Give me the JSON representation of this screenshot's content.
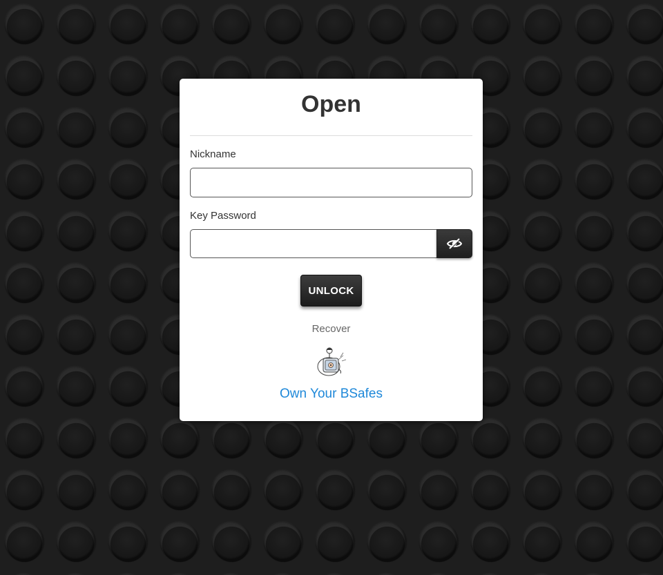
{
  "dialog": {
    "title": "Open",
    "nickname_label": "Nickname",
    "nickname_value": "",
    "password_label": "Key Password",
    "password_value": "",
    "toggle_visibility_icon": "eye-slash-icon",
    "unlock_label": "UNLOCK",
    "recover_label": "Recover",
    "mascot_icon": "safe-mascot-icon",
    "brand_link_label": "Own Your BSafes"
  },
  "colors": {
    "background": "#1e1e1e",
    "card": "#ffffff",
    "button": "#2a2a2a",
    "link": "#1e88d9",
    "muted_text": "#666666"
  }
}
